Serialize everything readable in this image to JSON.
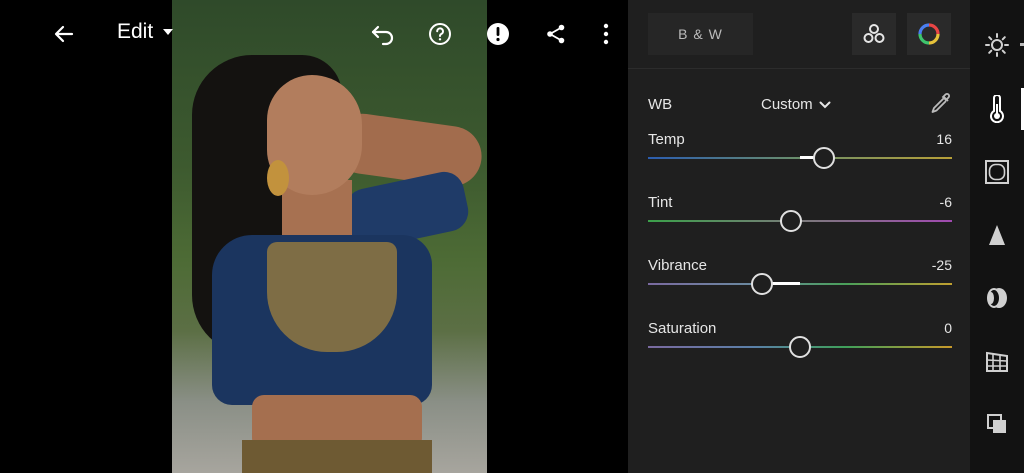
{
  "topbar": {
    "edit_label": "Edit",
    "icons": [
      "back-arrow-icon",
      "caret-down-icon",
      "undo-icon",
      "help-icon",
      "alert-icon",
      "share-icon",
      "more-vert-icon"
    ]
  },
  "panel": {
    "bw_label": "B & W",
    "wb": {
      "label": "WB",
      "value": "Custom"
    },
    "sliders": [
      {
        "label": "Temp",
        "value": "16",
        "level": 16
      },
      {
        "label": "Tint",
        "value": "-6",
        "level": -6
      },
      {
        "label": "Vibrance",
        "value": "-25",
        "level": -25
      },
      {
        "label": "Saturation",
        "value": "0",
        "level": 0
      }
    ],
    "slider_range": [
      -100,
      100
    ]
  },
  "tool_rail": [
    "light-icon",
    "color-icon",
    "effects-icon",
    "detail-icon",
    "optics-icon",
    "geometry-icon",
    "versions-icon"
  ],
  "colors": {
    "panel_bg": "#1f1f1f",
    "rail_bg": "#121212",
    "accent": "#ffffff"
  }
}
